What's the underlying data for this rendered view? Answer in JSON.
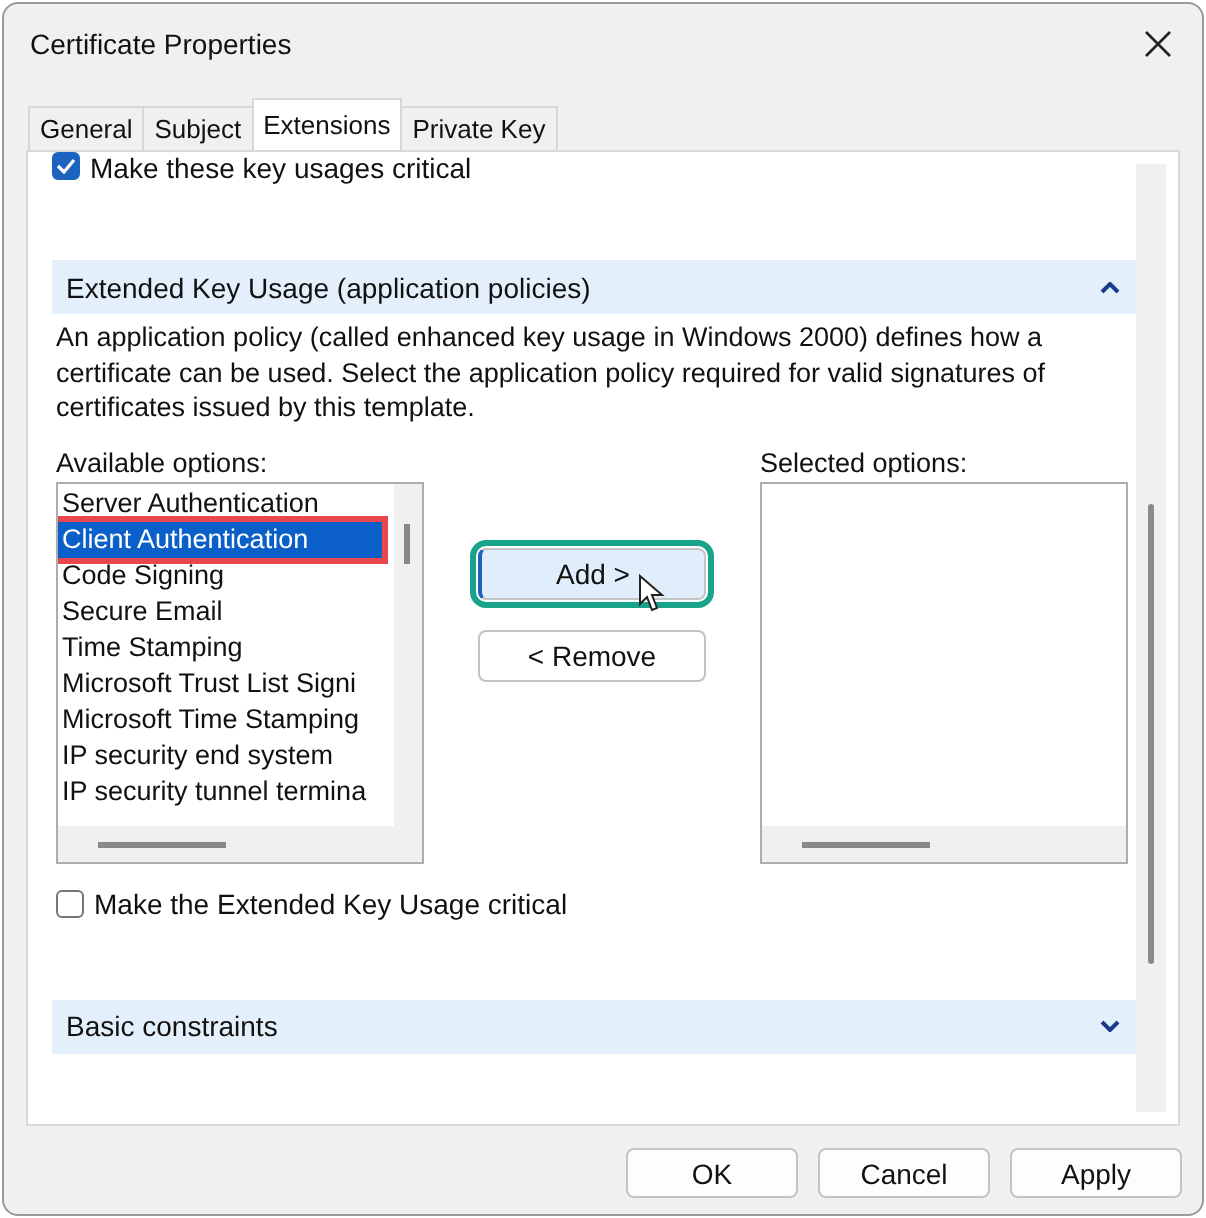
{
  "window": {
    "title": "Certificate Properties"
  },
  "tabs": [
    {
      "label": "General",
      "selected": false
    },
    {
      "label": "Subject",
      "selected": false
    },
    {
      "label": "Extensions",
      "selected": true
    },
    {
      "label": "Private Key",
      "selected": false
    }
  ],
  "top_checkbox": {
    "label": "Make these key usages critical",
    "checked": true
  },
  "sections": [
    {
      "title": "Extended Key Usage (application policies)",
      "expanded": true,
      "description": "An application policy (called enhanced key usage in Windows 2000) defines how a certificate can be used. Select the application policy required for valid signatures of certificates issued by this template.",
      "available_label": "Available options:",
      "available_options": [
        {
          "label": "Server Authentication",
          "selected": false,
          "outlined": false
        },
        {
          "label": "Client Authentication",
          "selected": true,
          "outlined": true
        },
        {
          "label": "Code Signing",
          "selected": false,
          "outlined": false
        },
        {
          "label": "Secure Email",
          "selected": false,
          "outlined": false
        },
        {
          "label": "Time Stamping",
          "selected": false,
          "outlined": false
        },
        {
          "label": "Microsoft Trust List Signi",
          "selected": false,
          "outlined": false
        },
        {
          "label": "Microsoft Time Stamping",
          "selected": false,
          "outlined": false
        },
        {
          "label": "IP security end system",
          "selected": false,
          "outlined": false
        },
        {
          "label": "IP security tunnel termina",
          "selected": false,
          "outlined": false
        }
      ],
      "buttons": [
        {
          "label": "Add >",
          "outlined": true,
          "hovered": true
        },
        {
          "label": "< Remove",
          "outlined": false,
          "hovered": false
        }
      ],
      "selected_label": "Selected options:",
      "critical_checkbox": {
        "label": "Make the Extended Key Usage critical",
        "checked": false
      }
    },
    {
      "title": "Basic constraints",
      "expanded": false
    }
  ],
  "footer_buttons": [
    "OK",
    "Cancel",
    "Apply"
  ]
}
